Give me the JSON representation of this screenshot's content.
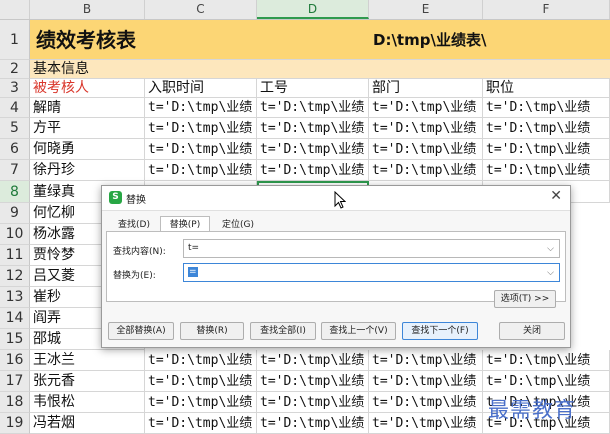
{
  "sheet": {
    "columns": [
      "B",
      "C",
      "D",
      "E",
      "F"
    ],
    "rows": [
      {
        "num": "1",
        "cells": [
          "绩效考核表",
          "",
          "D:\\tmp\\业绩表\\",
          "",
          ""
        ]
      },
      {
        "num": "2",
        "cells": [
          "基本信息",
          "",
          "",
          "",
          ""
        ]
      },
      {
        "num": "3",
        "cells": [
          "被考核人",
          "入职时间",
          "工号",
          "部门",
          "职位"
        ]
      },
      {
        "num": "4",
        "cells": [
          "解晴",
          "t='D:\\tmp\\业绩",
          "t='D:\\tmp\\业绩",
          "t='D:\\tmp\\业绩",
          "t='D:\\tmp\\业绩"
        ]
      },
      {
        "num": "5",
        "cells": [
          "方平",
          "t='D:\\tmp\\业绩",
          "t='D:\\tmp\\业绩",
          "t='D:\\tmp\\业绩",
          "t='D:\\tmp\\业绩"
        ]
      },
      {
        "num": "6",
        "cells": [
          "何晓勇",
          "t='D:\\tmp\\业绩",
          "t='D:\\tmp\\业绩",
          "t='D:\\tmp\\业绩",
          "t='D:\\tmp\\业绩"
        ]
      },
      {
        "num": "7",
        "cells": [
          "徐丹珍",
          "t='D:\\tmp\\业绩",
          "t='D:\\tmp\\业绩",
          "t='D:\\tmp\\业绩",
          "t='D:\\tmp\\业绩"
        ]
      },
      {
        "num": "8",
        "cells": [
          "董绿真",
          "",
          "",
          "",
          ""
        ]
      },
      {
        "num": "9",
        "cells": [
          "何忆柳",
          "",
          "",
          "",
          ""
        ]
      },
      {
        "num": "10",
        "cells": [
          "杨冰露",
          "",
          "",
          "",
          ""
        ]
      },
      {
        "num": "11",
        "cells": [
          "贾怜梦",
          "",
          "",
          "",
          ""
        ]
      },
      {
        "num": "12",
        "cells": [
          "吕又菱",
          "",
          "",
          "",
          ""
        ]
      },
      {
        "num": "13",
        "cells": [
          "崔秒",
          "",
          "",
          "",
          ""
        ]
      },
      {
        "num": "14",
        "cells": [
          "阎弄",
          "",
          "",
          "",
          ""
        ]
      },
      {
        "num": "15",
        "cells": [
          "邵城",
          "",
          "",
          "",
          ""
        ]
      },
      {
        "num": "16",
        "cells": [
          "王冰兰",
          "t='D:\\tmp\\业绩",
          "t='D:\\tmp\\业绩",
          "t='D:\\tmp\\业绩",
          "t='D:\\tmp\\业绩"
        ]
      },
      {
        "num": "17",
        "cells": [
          "张元香",
          "t='D:\\tmp\\业绩",
          "t='D:\\tmp\\业绩",
          "t='D:\\tmp\\业绩",
          "t='D:\\tmp\\业绩"
        ]
      },
      {
        "num": "18",
        "cells": [
          "韦恨松",
          "t='D:\\tmp\\业绩",
          "t='D:\\tmp\\业绩",
          "t='D:\\tmp\\业绩",
          "t='D:\\tmp\\业绩"
        ]
      },
      {
        "num": "19",
        "cells": [
          "冯若烟",
          "t='D:\\tmp\\业绩",
          "t='D:\\tmp\\业绩",
          "t='D:\\tmp\\业绩",
          "t='D:\\tmp\\业绩"
        ]
      }
    ],
    "selected_column": "D",
    "selected_row": "8",
    "colors": {
      "title_fill": "#fcd675",
      "header_text": "#d9362b",
      "selection": "#2f9a4e"
    }
  },
  "dialog": {
    "title": "替换",
    "app_icon": "wps-spreadsheet-icon",
    "tabs": [
      "查找(D)",
      "替换(P)",
      "定位(G)"
    ],
    "active_tab": "替换(P)",
    "find_label": "查找内容(N):",
    "find_value": "t=",
    "replace_label": "替换为(E):",
    "replace_value": "=",
    "options_button": "选项(T) >>",
    "buttons": [
      "全部替换(A)",
      "替换(R)",
      "查找全部(I)",
      "查找上一个(V)",
      "查找下一个(F)",
      "关闭"
    ]
  },
  "watermark": "最需教育"
}
